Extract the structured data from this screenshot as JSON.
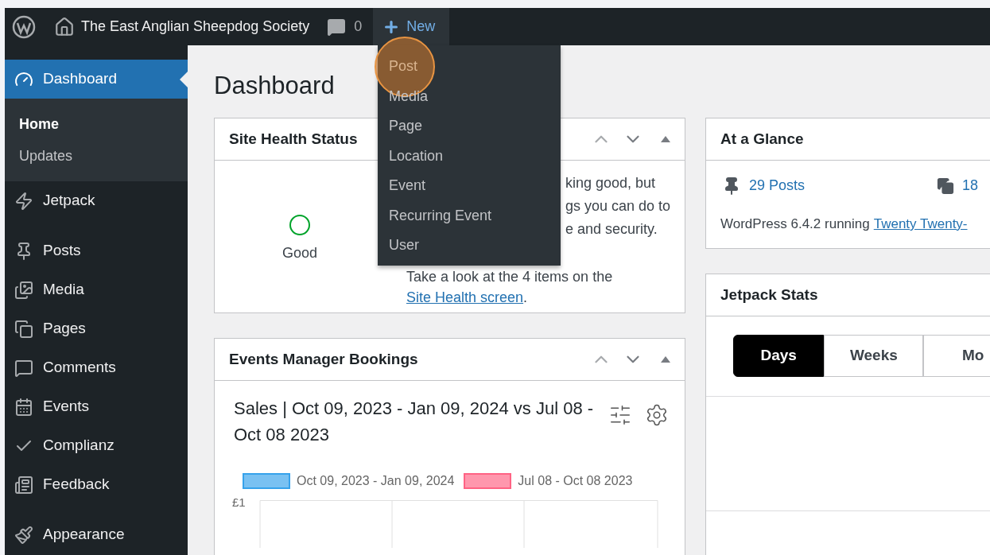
{
  "admin_bar": {
    "site_name": "The East Anglian Sheepdog Society",
    "comments_count": "0",
    "new_label": "New"
  },
  "new_menu": [
    {
      "label": "Post",
      "highlighted": true
    },
    {
      "label": "Media",
      "highlighted": false
    },
    {
      "label": "Page",
      "highlighted": false
    },
    {
      "label": "Location",
      "highlighted": false
    },
    {
      "label": "Event",
      "highlighted": false
    },
    {
      "label": "Recurring Event",
      "highlighted": false
    },
    {
      "label": "User",
      "highlighted": false
    }
  ],
  "sidebar": {
    "groups": [
      [
        {
          "label": "Dashboard",
          "selected": true,
          "children": [
            {
              "label": "Home",
              "selected": true
            },
            {
              "label": "Updates",
              "selected": false
            }
          ]
        },
        {
          "label": "Jetpack",
          "selected": false
        }
      ],
      [
        {
          "label": "Posts",
          "selected": false
        },
        {
          "label": "Media",
          "selected": false
        },
        {
          "label": "Pages",
          "selected": false
        },
        {
          "label": "Comments",
          "selected": false
        },
        {
          "label": "Events",
          "selected": false
        },
        {
          "label": "Complianz",
          "selected": false
        },
        {
          "label": "Feedback",
          "selected": false
        }
      ],
      [
        {
          "label": "Appearance",
          "selected": false
        }
      ]
    ]
  },
  "page_title": "Dashboard",
  "site_health": {
    "title": "Site Health Status",
    "status": "Good",
    "visible_lines": [
      "king good, but",
      "gs you can do to",
      "e and security."
    ],
    "note": "Take a look at the 4 items on the",
    "link": "Site Health screen",
    "note_end": "."
  },
  "bookings": {
    "title": "Events Manager Bookings",
    "sales_title": "Sales | Oct 09, 2023 - Jan 09, 2024 vs Jul 08 - Oct 08 2023",
    "legend": [
      {
        "label": "Oct 09, 2023 - Jan 09, 2024",
        "color": "#36a2eb"
      },
      {
        "label": "Jul 08 - Oct 08 2023",
        "color": "#ff6384"
      }
    ],
    "y_tick": "£1"
  },
  "at_a_glance": {
    "title": "At a Glance",
    "items": [
      "29 Posts",
      "18"
    ],
    "footer": "WordPress 6.4.2 running",
    "theme_link": "Twenty Twenty-"
  },
  "jetpack_stats": {
    "title": "Jetpack Stats",
    "tabs": [
      {
        "label": "Days",
        "selected": true
      },
      {
        "label": "Weeks",
        "selected": false
      },
      {
        "label": "Mo",
        "selected": false
      }
    ]
  }
}
